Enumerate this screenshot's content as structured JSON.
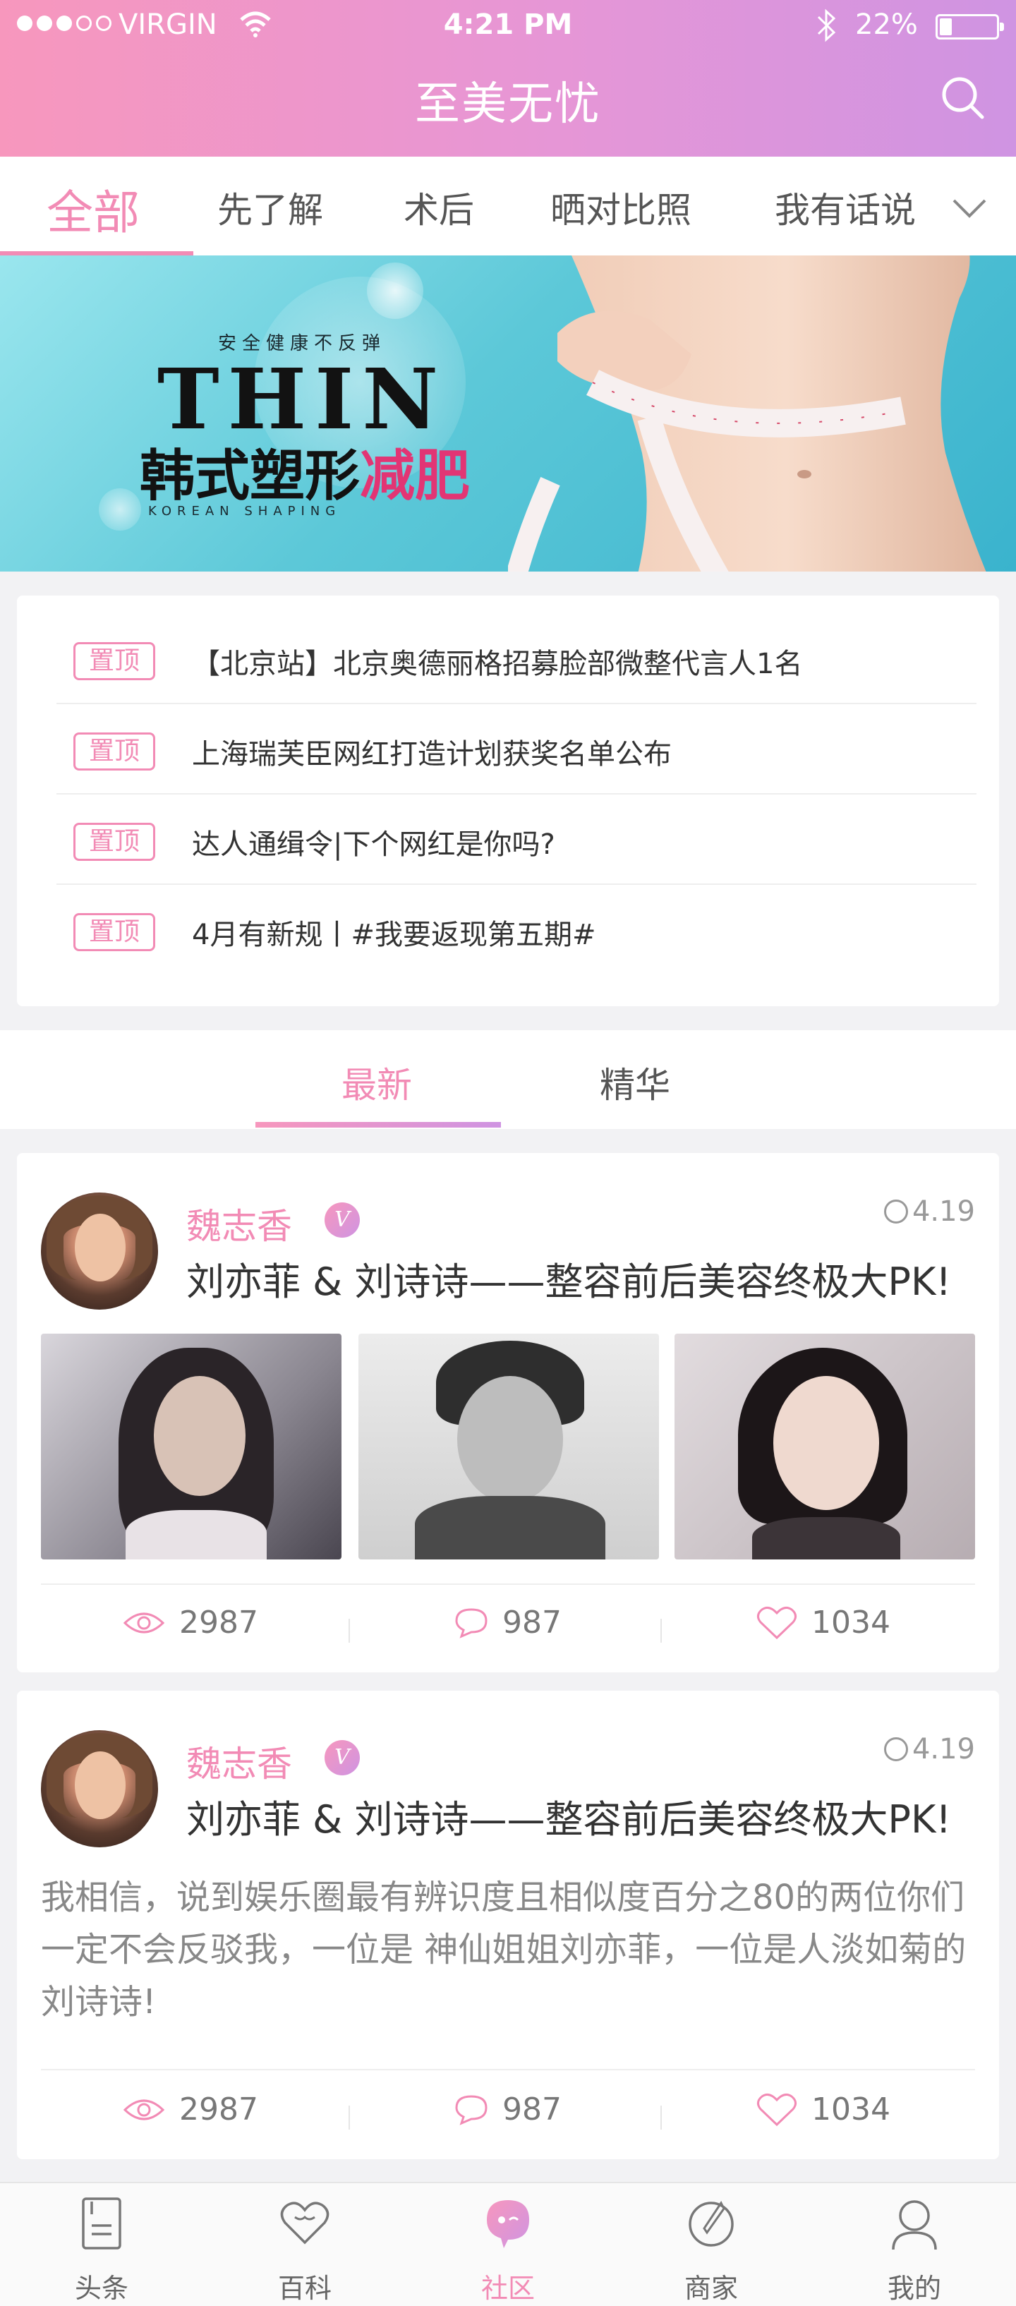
{
  "status_bar": {
    "carrier": "VIRGIN",
    "time": "4:21 PM",
    "battery": "22%",
    "battery_level": 0.22
  },
  "header": {
    "title": "至美无忧"
  },
  "tabs": [
    {
      "label": "全部",
      "active": true
    },
    {
      "label": "先了解"
    },
    {
      "label": "术后"
    },
    {
      "label": "晒对比照"
    },
    {
      "label": "我有话说"
    }
  ],
  "banner": {
    "slogan": "安全健康不反弹",
    "headline": "THIN",
    "cn_title_black": "韩式塑形",
    "cn_title_pink": "减肥",
    "subline": "KOREAN SHAPING"
  },
  "notices": [
    {
      "badge": "置顶",
      "text": "【北京站】北京奥德丽格招募脸部微整代言人1名"
    },
    {
      "badge": "置顶",
      "text": "上海瑞芙臣网红打造计划获奖名单公布"
    },
    {
      "badge": "置顶",
      "text": "达人通缉令|下个网红是你吗?"
    },
    {
      "badge": "置顶",
      "text": "4月有新规丨#我要返现第五期#"
    }
  ],
  "sub_tabs": [
    {
      "label": "最新",
      "active": true
    },
    {
      "label": "精华"
    }
  ],
  "posts": [
    {
      "author": "魏志香",
      "badge": "V",
      "date": "4.19",
      "title": "刘亦菲 & 刘诗诗——整容前后美容终极大PK!",
      "views": "2987",
      "comments": "987",
      "likes": "1034"
    },
    {
      "author": "魏志香",
      "badge": "V",
      "date": "4.19",
      "title": "刘亦菲 & 刘诗诗——整容前后美容终极大PK!",
      "excerpt": "我相信，说到娱乐圈最有辨识度且相似度百分之80的两位你们一定不会反驳我，一位是 神仙姐姐刘亦菲，一位是人淡如菊的刘诗诗!",
      "views": "2987",
      "comments": "987",
      "likes": "1034"
    }
  ],
  "bottom_nav": [
    {
      "label": "头条",
      "icon": "document-icon"
    },
    {
      "label": "百科",
      "icon": "heart-icon"
    },
    {
      "label": "社区",
      "icon": "chat-bubble-icon",
      "active": true
    },
    {
      "label": "商家",
      "icon": "compass-icon"
    },
    {
      "label": "我的",
      "icon": "person-icon"
    }
  ],
  "colors": {
    "accent": "#f28bb5",
    "header_start": "#f797bd",
    "header_end": "#cf94e2"
  }
}
